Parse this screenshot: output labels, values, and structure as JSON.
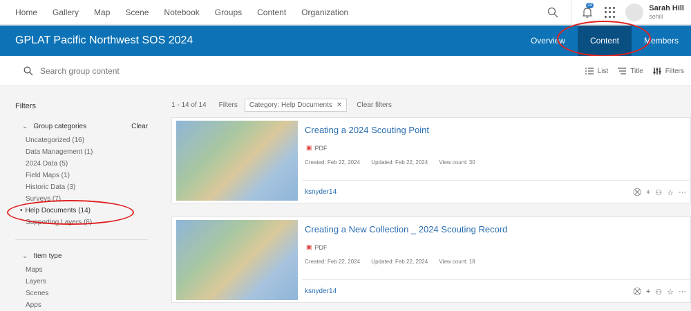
{
  "topnav": {
    "items": [
      "Home",
      "Gallery",
      "Map",
      "Scene",
      "Notebook",
      "Groups",
      "Content",
      "Organization"
    ],
    "notification_count": "24",
    "user": {
      "name": "Sarah Hill",
      "id": "sehill"
    }
  },
  "group": {
    "title": "GPLAT Pacific Northwest SOS 2024",
    "tabs": [
      "Overview",
      "Content",
      "Members"
    ],
    "active_tab": "Content"
  },
  "search": {
    "placeholder": "Search group content"
  },
  "view_controls": {
    "list": "List",
    "title": "Title",
    "filters": "Filters"
  },
  "sidebar": {
    "title": "Filters",
    "group_categories": {
      "heading": "Group categories",
      "clear": "Clear",
      "items": [
        "Uncategorized (16)",
        "Data Management (1)",
        "2024 Data (5)",
        "Field Maps (1)",
        "Historic Data (3)",
        "Surveys (7)",
        "Help Documents (14)",
        "Supporting Layers (6)"
      ],
      "active_index": 6
    },
    "item_type": {
      "heading": "Item type",
      "items": [
        "Maps",
        "Layers",
        "Scenes",
        "Apps"
      ]
    }
  },
  "results": {
    "count": "1 - 14 of 14",
    "filters_label": "Filters",
    "chip": "Category: Help Documents",
    "clear_filters": "Clear filters"
  },
  "cards": [
    {
      "title": "Creating a 2024 Scouting Point",
      "type": "PDF",
      "created": "Created: Feb 22, 2024",
      "updated": "Updated: Feb 22, 2024",
      "views": "View count: 30",
      "owner": "ksnyder14"
    },
    {
      "title": "Creating a New Collection _ 2024 Scouting Record",
      "type": "PDF",
      "created": "Created: Feb 22, 2024",
      "updated": "Updated: Feb 22, 2024",
      "views": "View count: 18",
      "owner": "ksnyder14"
    }
  ],
  "colors": {
    "brand": "#0e73b6",
    "active_tab": "#0a4f82",
    "link": "#2a6eb0",
    "annotation": "#e02020"
  }
}
